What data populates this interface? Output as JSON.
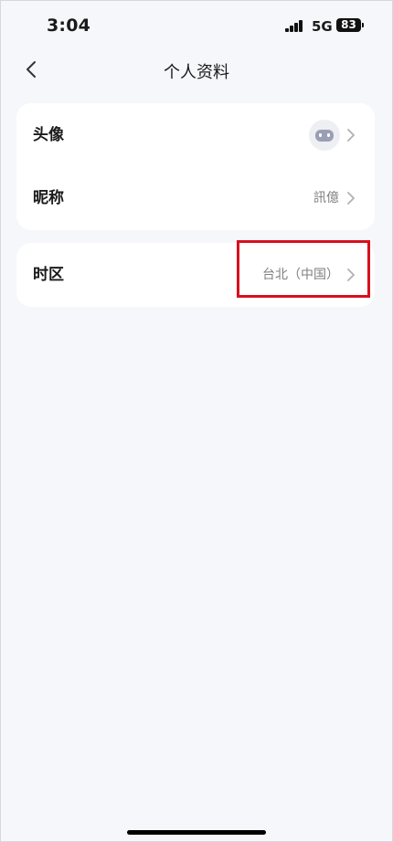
{
  "status_bar": {
    "time": "3:04",
    "network": "5G",
    "battery": "83"
  },
  "nav": {
    "title": "个人资料",
    "back_icon": "chevron-left-icon"
  },
  "profile_rows": [
    {
      "label": "头像",
      "value_type": "avatar",
      "icon": "avatar-robot-icon"
    },
    {
      "label": "昵称",
      "value": "訊億"
    }
  ],
  "settings_rows": [
    {
      "label": "时区",
      "value": "台北（中国）"
    }
  ],
  "colors": {
    "background": "#f6f7fb",
    "card": "#ffffff",
    "secondary_text": "#808080",
    "highlight": "#d90f1c"
  }
}
